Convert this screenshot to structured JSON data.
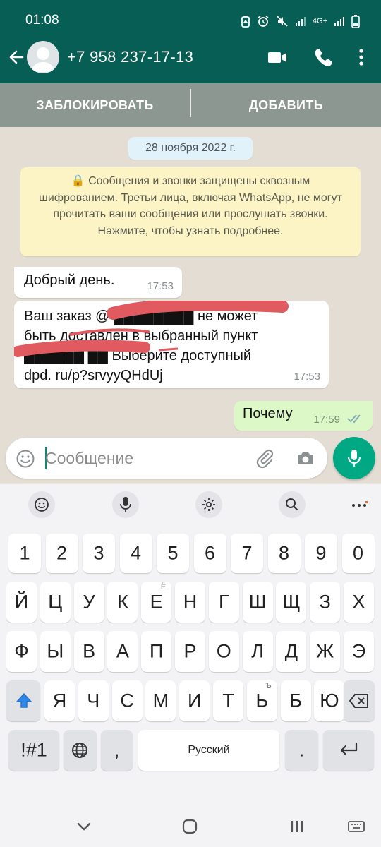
{
  "status_bar": {
    "time": "01:08",
    "network": "4G+"
  },
  "header": {
    "contact_name": "+7 958 237-17-13"
  },
  "action_bar": {
    "block_label": "ЗАБЛОКИРОВАТЬ",
    "add_label": "ДОБАВИТЬ"
  },
  "chat": {
    "date_chip": "28 ноября 2022 г.",
    "encryption_notice": "🔒 Сообщения и звонки защищены сквозным шифрованием. Третьи лица, включая WhatsApp, не могут прочитать ваши сообщения или прослушать звонки. Нажмите, чтобы узнать подробнее.",
    "messages": [
      {
        "direction": "in",
        "lines": [
          "Добрый день."
        ],
        "time": "17:53"
      },
      {
        "direction": "in",
        "lines": [
          "Ваш заказ @ ████████ не может",
          "быть доставлен в выбранный пункт",
          "██████ ██ Выберите доступный",
          "dpd. ru/p?srvyyQHdUj"
        ],
        "time": "17:53"
      },
      {
        "direction": "out",
        "lines": [
          "Почему"
        ],
        "time": "17:59",
        "status": "read"
      }
    ]
  },
  "composer": {
    "placeholder": "Сообщение"
  },
  "keyboard": {
    "numbers": [
      "1",
      "2",
      "3",
      "4",
      "5",
      "6",
      "7",
      "8",
      "9",
      "0"
    ],
    "row1": [
      "Й",
      "Ц",
      "У",
      "К",
      "Е",
      "Н",
      "Г",
      "Ш",
      "Щ",
      "З",
      "Х"
    ],
    "row1_hints": {
      "Е": "Ё"
    },
    "row2": [
      "Ф",
      "Ы",
      "В",
      "А",
      "П",
      "Р",
      "О",
      "Л",
      "Д",
      "Ж",
      "Э"
    ],
    "row3": [
      "Я",
      "Ч",
      "С",
      "М",
      "И",
      "Т",
      "Ь",
      "Б",
      "Ю"
    ],
    "row3_hints": {
      "Ь": "Ъ"
    },
    "symbols_label": "!#1",
    "comma": ",",
    "space_label": "Русский",
    "period": "."
  },
  "colors": {
    "header": "#075e54",
    "accent": "#00a884",
    "outgoing_bubble": "#dcf8c6",
    "notice": "#fdf4c5"
  }
}
